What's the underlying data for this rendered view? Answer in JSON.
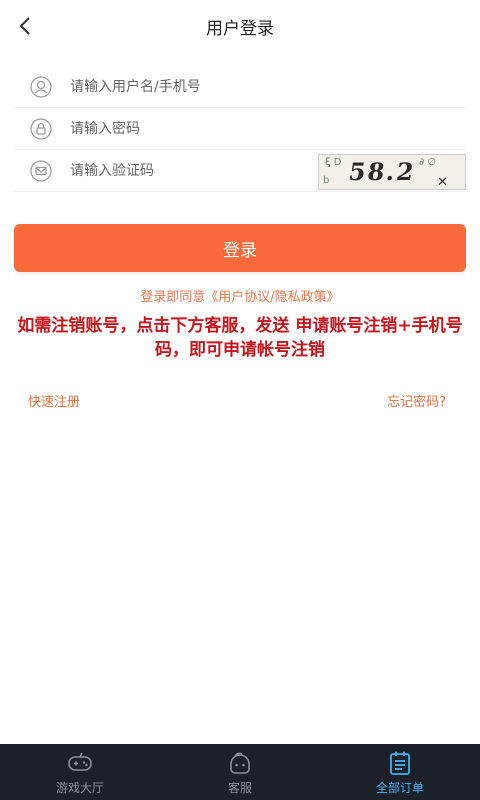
{
  "header": {
    "title": "用户登录"
  },
  "form": {
    "username_placeholder": "请输入用户名/手机号",
    "password_placeholder": "请输入密码",
    "captcha_placeholder": "请输入验证码",
    "captcha_code": "58.2"
  },
  "login_button": "登录",
  "agreement_text": "登录即同意《用户协议/隐私政策》",
  "notice_text": "如需注销账号，点击下方客服，发送 申请账号注销+手机号码，即可申请帐号注销",
  "links": {
    "register": "快速注册",
    "forgot": "忘记密码?"
  },
  "tabbar": {
    "items": [
      {
        "label": "游戏大厅",
        "icon": "gamepad-icon",
        "active": false
      },
      {
        "label": "客服",
        "icon": "customer-service-icon",
        "active": false
      },
      {
        "label": "全部订单",
        "icon": "clipboard-icon",
        "active": true
      }
    ]
  },
  "colors": {
    "accent": "#f86a3c",
    "notice": "#c8161d",
    "link": "#e0703f",
    "tab_active": "#3fb4f2",
    "tabbar_bg": "#1b2029"
  }
}
